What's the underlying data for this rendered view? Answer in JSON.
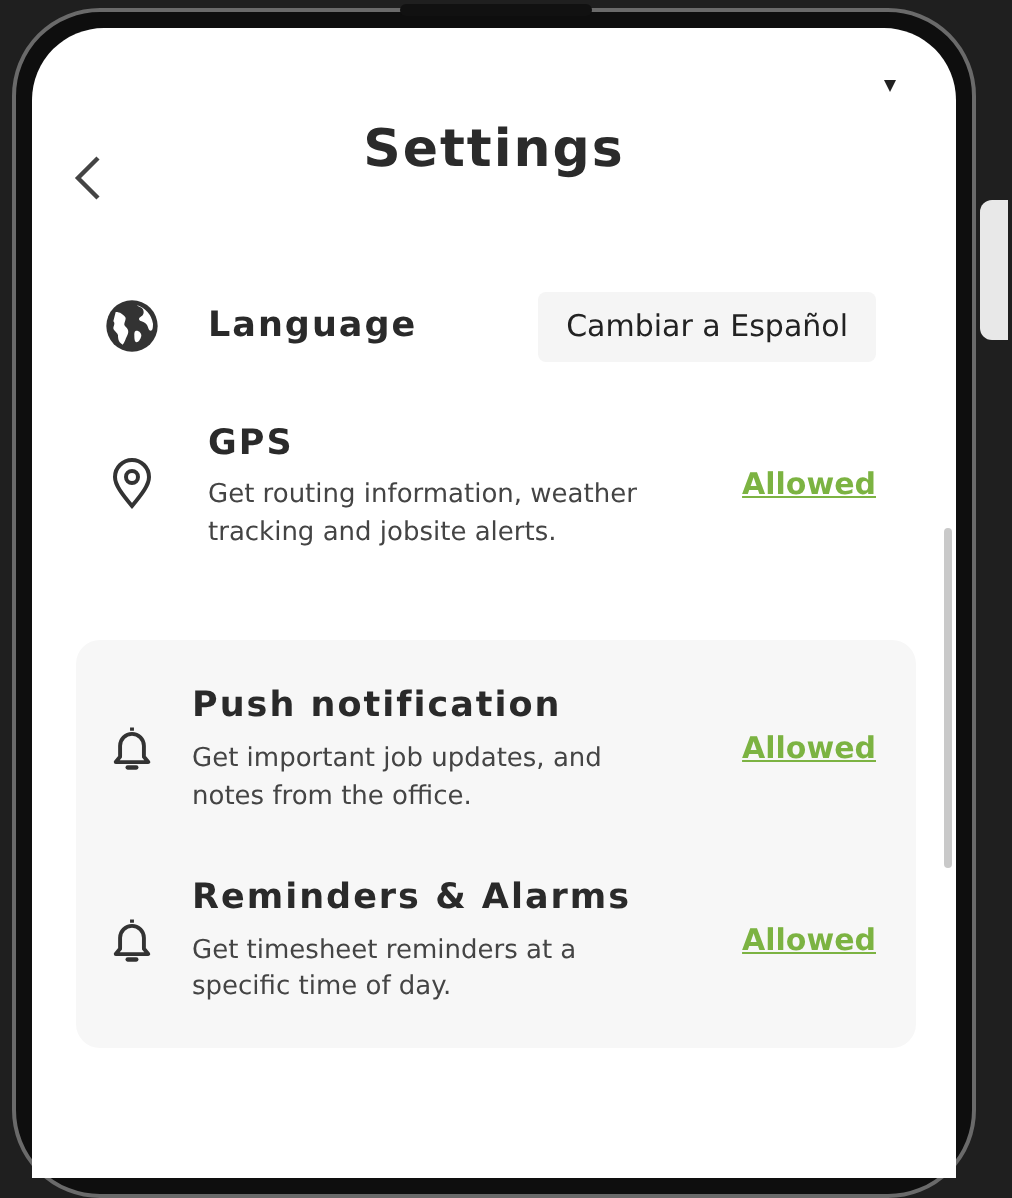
{
  "header": {
    "title": "Settings"
  },
  "sections": [
    {
      "highlighted": false,
      "items": [
        {
          "kind": "language",
          "title": "Language",
          "action": "Cambiar a Español"
        },
        {
          "kind": "location",
          "title": "GPS",
          "description": "Get routing information, weather tracking and jobsite alerts.",
          "action": "Allowed"
        }
      ]
    },
    {
      "highlighted": true,
      "items": [
        {
          "kind": "alert",
          "title": "Push notification",
          "description": "Get important job updates, and notes from the office.",
          "action": "Allowed"
        },
        {
          "kind": "alert",
          "title": "Reminders & Alarms",
          "description": "Get timesheet reminders at a specific time of day.",
          "action": "Allowed"
        }
      ]
    }
  ]
}
